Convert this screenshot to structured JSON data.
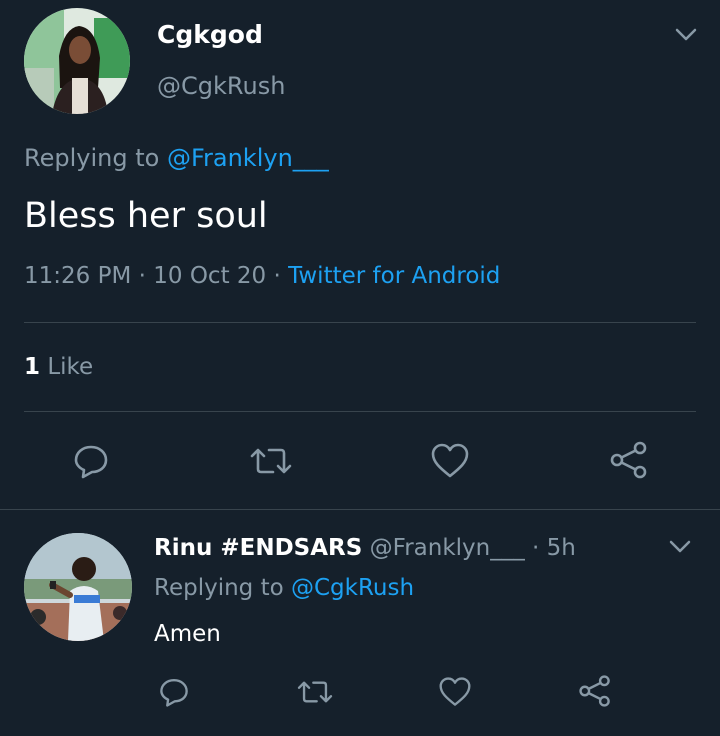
{
  "main_tweet": {
    "display_name": "Cgkgod",
    "handle": "@CgkRush",
    "replying_prefix": "Replying to",
    "replying_to": "@Franklyn___",
    "text": "Bless her soul",
    "time": "11:26 PM",
    "separator": "·",
    "date": "10 Oct 20",
    "source": "Twitter for Android",
    "likes_count": "1",
    "likes_label": "Like"
  },
  "reply_tweet": {
    "display_name": "Rinu #ENDSARS",
    "handle": "@Franklyn___",
    "age": "· 5h",
    "replying_prefix": "Replying to",
    "replying_to": "@CgkRush",
    "text": "Amen"
  },
  "colors": {
    "background": "#15202b",
    "link": "#1da1f2",
    "muted": "#8899a6",
    "divider": "#38444d"
  },
  "icons": [
    "chevron-down-icon",
    "reply-icon",
    "retweet-icon",
    "like-icon",
    "share-icon"
  ]
}
